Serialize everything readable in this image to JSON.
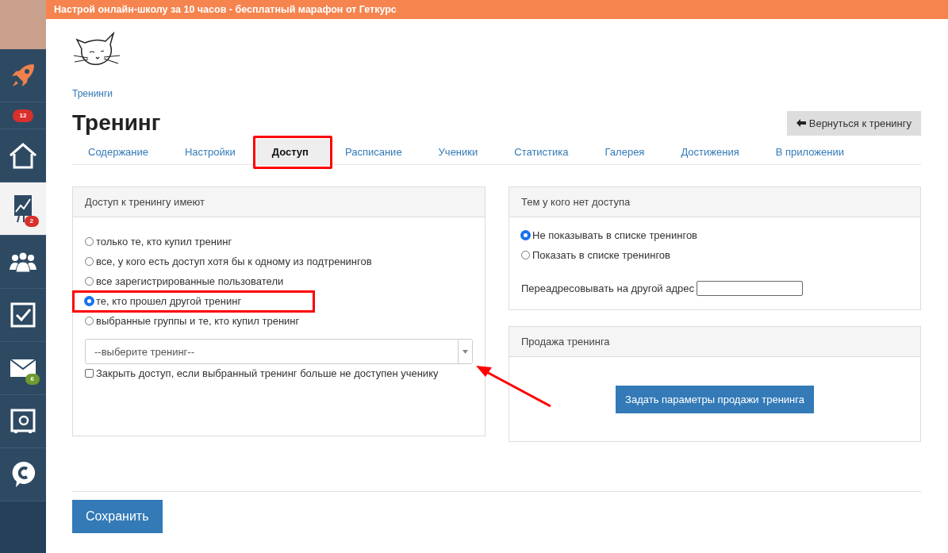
{
  "promo_banner": {
    "text": "Настрой онлайн-школу за 10 часов - бесплатный марафон от Геткурс"
  },
  "sidebar": {
    "items": [
      {
        "kind": "rocket",
        "selected": false
      },
      {
        "kind": "counter",
        "badge": "12",
        "selected": false
      },
      {
        "kind": "home",
        "selected": false
      },
      {
        "kind": "chart",
        "badge": "2",
        "selected": true
      },
      {
        "kind": "people",
        "selected": false
      },
      {
        "kind": "check",
        "selected": false
      },
      {
        "kind": "mail",
        "badge": "6",
        "selected": false
      },
      {
        "kind": "safe",
        "selected": false
      },
      {
        "kind": "chat",
        "selected": false
      }
    ]
  },
  "breadcrumb": "Тренинги",
  "title": "Тренинг",
  "back_button": "Вернуться к тренингу",
  "tabs": [
    {
      "label": "Содержание",
      "selected": false
    },
    {
      "label": "Настройки",
      "selected": false
    },
    {
      "label": "Доступ",
      "selected": true
    },
    {
      "label": "Расписание",
      "selected": false
    },
    {
      "label": "Ученики",
      "selected": false
    },
    {
      "label": "Статистика",
      "selected": false
    },
    {
      "label": "Галерея",
      "selected": false
    },
    {
      "label": "Достижения",
      "selected": false
    },
    {
      "label": "В приложении",
      "selected": false
    }
  ],
  "access_panel": {
    "title": "Доступ к тренингу имеют",
    "options": [
      {
        "label": "только те, кто купил тренинг",
        "selected": false
      },
      {
        "label": "все, у кого есть доступ хотя бы к одному из подтренингов",
        "selected": false
      },
      {
        "label": "все зарегистрированные пользователи",
        "selected": false
      },
      {
        "label": "те, кто прошел другой тренинг",
        "selected": true
      },
      {
        "label": "выбранные группы и те, кто купил тренинг",
        "selected": false
      }
    ],
    "training_select": {
      "placeholder": "--выберите тренинг--"
    },
    "close_access": {
      "label": "Закрыть доступ, если выбранный тренинг больше не доступен ученику",
      "checked": false
    }
  },
  "no_access_panel": {
    "title": "Тем у кого нет доступа",
    "options": [
      {
        "label": "Не показывать в списке тренингов",
        "selected": true
      },
      {
        "label": "Показать в списке тренингов",
        "selected": false
      }
    ],
    "redirect_label": "Переадресовывать на другой адрес"
  },
  "sale_panel": {
    "title": "Продажа тренинга",
    "button": "Задать параметры продажи тренинга"
  },
  "save_button": "Сохранить"
}
